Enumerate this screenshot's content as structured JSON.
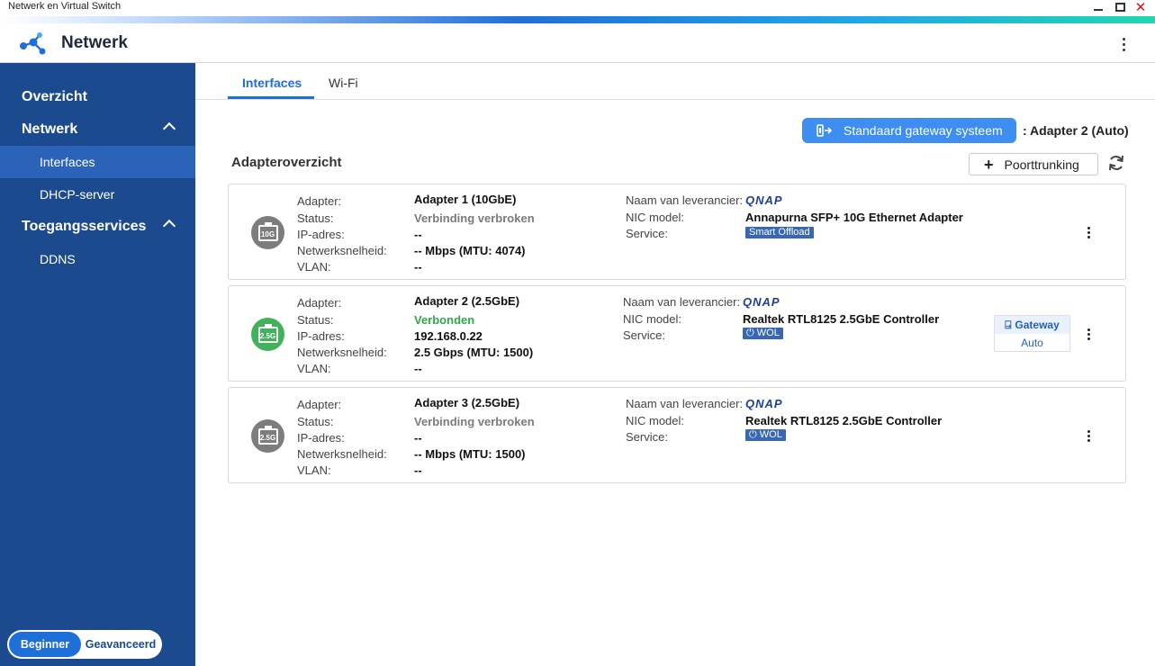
{
  "window": {
    "title": "Netwerk en Virtual Switch"
  },
  "app": {
    "title": "Netwerk"
  },
  "sidebar": {
    "overview": "Overzicht",
    "network": "Netwerk",
    "interfaces": "Interfaces",
    "dhcp": "DHCP-server",
    "access_services": "Toegangsservices",
    "ddns": "DDNS"
  },
  "mode": {
    "beginner": "Beginner",
    "advanced": "Geavanceerd",
    "selected": "Beginner"
  },
  "tabs": {
    "interfaces": "Interfaces",
    "wifi": "Wi-Fi",
    "active": "Interfaces"
  },
  "gateway": {
    "button_label": "Standaard gateway systeem",
    "value": ":  Adapter 2 (Auto)"
  },
  "overview": {
    "title": "Adapteroverzicht",
    "trunk_button": "Poorttrunking"
  },
  "labels": {
    "adapter": "Adapter:",
    "status": "Status:",
    "ip": "IP-adres:",
    "speed": "Netwerksnelheid:",
    "vlan": "VLAN:",
    "vendor": "Naam van leverancier:",
    "nic": "NIC model:",
    "service": "Service:"
  },
  "adapters": [
    {
      "port_label": "10G",
      "name": "Adapter 1 (10GbE)",
      "status": "Verbinding verbroken",
      "status_state": "disconnected",
      "ip": "--",
      "speed": "-- Mbps (MTU: 4074)",
      "vlan": "--",
      "vendor": "QNAP",
      "nic_model": "Annapurna SFP+ 10G Ethernet Adapter",
      "service": "Smart Offload"
    },
    {
      "port_label": "2.5G",
      "name": "Adapter 2 (2.5GbE)",
      "status": "Verbonden",
      "status_state": "connected",
      "ip": "192.168.0.22",
      "speed": "2.5 Gbps (MTU: 1500)",
      "vlan": "--",
      "vendor": "QNAP",
      "nic_model": "Realtek RTL8125 2.5GbE Controller",
      "service": "WOL",
      "gateway_tag": "Gateway",
      "gateway_mode": "Auto"
    },
    {
      "port_label": "2.5G",
      "name": "Adapter 3 (2.5GbE)",
      "status": "Verbinding verbroken",
      "status_state": "disconnected",
      "ip": "--",
      "speed": "-- Mbps (MTU: 1500)",
      "vlan": "--",
      "vendor": "QNAP",
      "nic_model": "Realtek RTL8125 2.5GbE Controller",
      "service": "WOL"
    }
  ],
  "colors": {
    "sidebar": "#1b4a8f",
    "accent": "#1f6fd9",
    "connected": "#2fa84a",
    "disconnected": "#7d7d7d"
  }
}
